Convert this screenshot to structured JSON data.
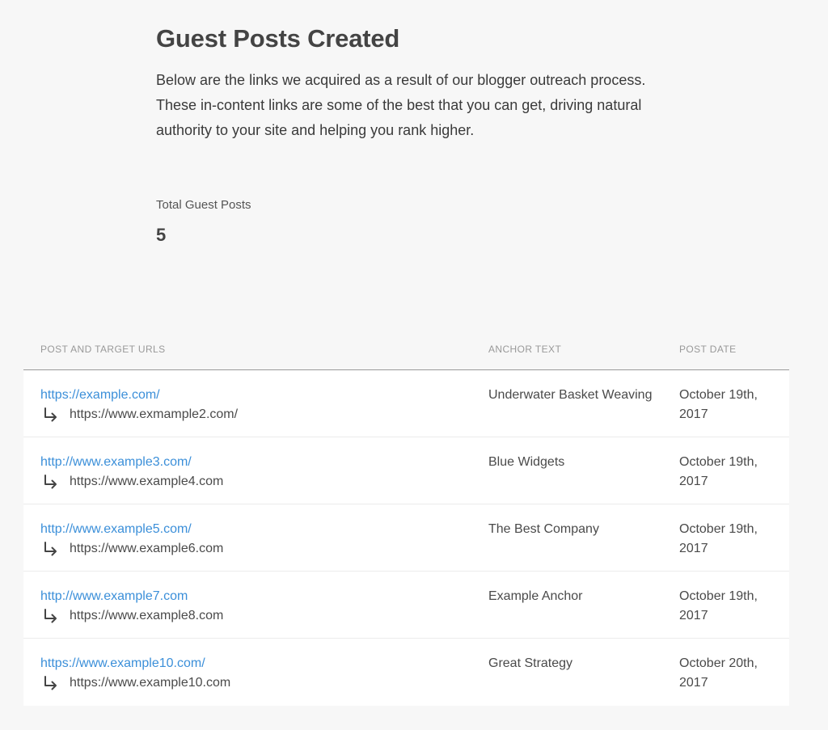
{
  "header": {
    "title": "Guest Posts Created",
    "description": "Below are the links we acquired as a result of our blogger outreach process. These in-content links are some of the best that you can get, driving natural authority to your site and helping you rank higher."
  },
  "stats": {
    "total_label": "Total Guest Posts",
    "total_value": "5"
  },
  "table": {
    "columns": [
      "POST AND TARGET URLS",
      "ANCHOR TEXT",
      "POST DATE"
    ],
    "rows": [
      {
        "post_url": "https://example.com/",
        "target_url": "https://www.exmample2.com/",
        "anchor": "Underwater Basket Weaving",
        "date": "October 19th, 2017"
      },
      {
        "post_url": "http://www.example3.com/",
        "target_url": "https://www.example4.com",
        "anchor": "Blue Widgets",
        "date": "October 19th, 2017"
      },
      {
        "post_url": "http://www.example5.com/",
        "target_url": "https://www.example6.com",
        "anchor": "The Best Company",
        "date": "October 19th, 2017"
      },
      {
        "post_url": "http://www.example7.com",
        "target_url": "https://www.example8.com",
        "anchor": "Example Anchor",
        "date": "October 19th, 2017"
      },
      {
        "post_url": "https://www.example10.com/",
        "target_url": "https://www.example10.com",
        "anchor": "Great Strategy",
        "date": "October 20th, 2017"
      }
    ]
  },
  "colors": {
    "link": "#3b8fd9",
    "background": "#f7f7f7",
    "row_background": "#ffffff"
  },
  "icons": {
    "target_arrow": "return-arrow-icon"
  }
}
